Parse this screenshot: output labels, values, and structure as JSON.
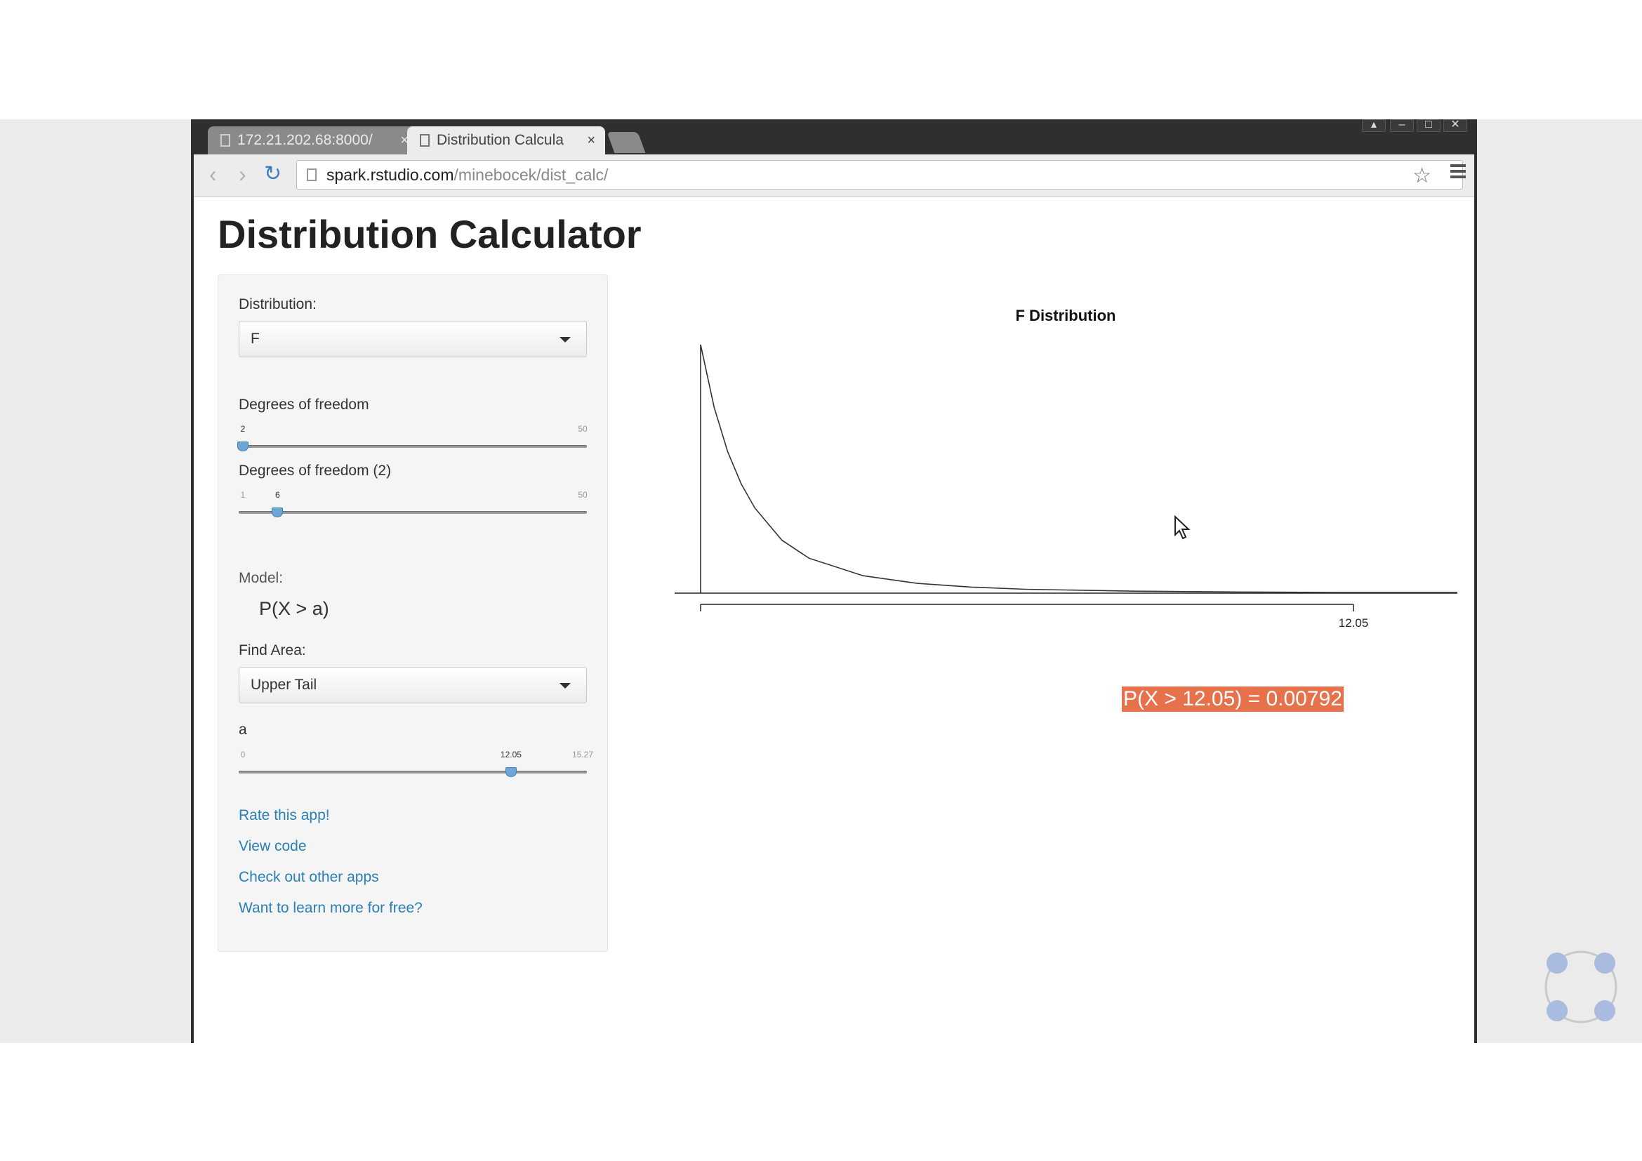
{
  "browser": {
    "tabs": [
      {
        "title": "172.21.202.68:8000/",
        "active": false
      },
      {
        "title": "Distribution Calcula",
        "active": true
      }
    ],
    "url_host": "spark.rstudio.com",
    "url_path": "/minebocek/dist_calc/"
  },
  "app": {
    "title": "Distribution Calculator",
    "sidebar": {
      "distribution_label": "Distribution:",
      "distribution_value": "F",
      "df1": {
        "label": "Degrees of freedom",
        "min": 2,
        "max": 50,
        "value": 2,
        "min_label": "",
        "value_label": "2",
        "max_label": "50"
      },
      "df2": {
        "label": "Degrees of freedom (2)",
        "min": 1,
        "max": 50,
        "value": 6,
        "min_label": "1",
        "value_label": "6",
        "max_label": "50"
      },
      "model_label": "Model:",
      "model_expr": "P(X > a)",
      "find_area_label": "Find Area:",
      "find_area_value": "Upper Tail",
      "a": {
        "label": "a",
        "min": 0,
        "max": 15.27,
        "value": 12.05,
        "min_label": "0",
        "value_label": "12.05",
        "max_label": "15.27"
      },
      "links": [
        "Rate this app!",
        "View code",
        "Check out other apps",
        "Want to learn more for free?"
      ]
    },
    "result": "P(X > 12.05) = 0.00792",
    "colors": {
      "accent": "#e7714a",
      "link": "#2a7fb3",
      "slider_handle": "#6ea6d8"
    }
  },
  "chart_data": {
    "type": "line",
    "title": "F Distribution",
    "distribution": "F",
    "df1": 2,
    "df2": 6,
    "xlim": [
      0,
      12.05
    ],
    "tick_labels": [
      "12.05"
    ],
    "shaded_region": "upper tail, x > 12.05",
    "series": [
      {
        "x": [
          0,
          0.25,
          0.5,
          0.75,
          1,
          1.5,
          2,
          3,
          4,
          5,
          6,
          8,
          10,
          12.05
        ],
        "y": [
          1.0,
          0.7477,
          0.5689,
          0.4392,
          0.343,
          0.2131,
          0.1406,
          0.07,
          0.0394,
          0.0244,
          0.0156,
          0.0078,
          0.0044,
          0.0026
        ]
      }
    ]
  }
}
